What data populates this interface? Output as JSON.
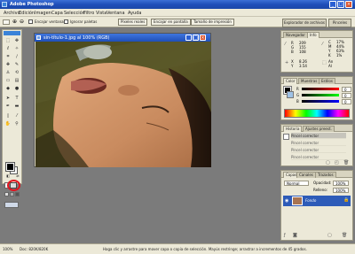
{
  "app": {
    "title": "Adobe Photoshop"
  },
  "window_controls": {
    "minimize": "_",
    "maximize": "□",
    "close": "×"
  },
  "menu": [
    "Archivo",
    "Edición",
    "Imagen",
    "Capa",
    "Selección",
    "Filtro",
    "Vista",
    "Ventana",
    "Ayuda"
  ],
  "options_bar": {
    "resize_windows_label": "Encajar ventanas",
    "ignore_palettes_label": "Ignorar paletas",
    "actual_pixels": "Píxeles reales",
    "fit_on_screen": "Encajar en pantalla",
    "print_size": "Tamaño de impresión",
    "file_browser": "Explorador de archivos",
    "brushes": "Pinceles"
  },
  "document": {
    "title": "sin-título-1.jpg al 100% (RGB)",
    "window_controls": {
      "minimize": "_",
      "maximize": "□",
      "close": "×"
    }
  },
  "navigator": {
    "tabs": [
      "Navegador",
      "Info"
    ],
    "readouts": [
      {
        "label": "R",
        "value": "209"
      },
      {
        "label": "G",
        "value": "155"
      },
      {
        "label": "B",
        "value": "108"
      },
      {
        "label": "C",
        "value": "17%"
      },
      {
        "label": "M",
        "value": "44%"
      },
      {
        "label": "Y",
        "value": "63%"
      },
      {
        "label": "K",
        "value": "1%"
      },
      {
        "label": "X",
        "value": "8.26"
      },
      {
        "label": "Y",
        "value": "3.54"
      },
      {
        "label": "An",
        "value": ""
      },
      {
        "label": "Al",
        "value": ""
      }
    ]
  },
  "color_panel": {
    "tabs": [
      "Color",
      "Muestras",
      "Estilos"
    ],
    "sliders": [
      {
        "label": "R",
        "value": "0",
        "color": "#e03030"
      },
      {
        "label": "G",
        "value": "0",
        "color": "#30b030"
      },
      {
        "label": "B",
        "value": "0",
        "color": "#3050e0"
      }
    ]
  },
  "history": {
    "tabs": [
      "Historia",
      "Ajustes preest."
    ],
    "items": [
      {
        "label": "Pincel corrector",
        "active": true
      },
      {
        "label": "Pincel corrector",
        "active": false
      },
      {
        "label": "Pincel corrector",
        "active": false
      },
      {
        "label": "Pincel corrector",
        "active": false
      }
    ]
  },
  "layers": {
    "tabs": [
      "Capas",
      "Canales",
      "Trazados"
    ],
    "blend_mode": "Normal",
    "opacity_label": "Opacidad:",
    "opacity": "100%",
    "fill_label": "Relleno:",
    "fill": "100%",
    "layer_name": "Fondo"
  },
  "statusbar": {
    "zoom": "100%",
    "doc_size": "Doc: 820K/820K",
    "hint": "Haga clic y arrastre para mover capa o copia de selección. Mayús restringe; arrastrar a incrementos de 45 grados."
  },
  "colors": {
    "title_blue": "#1f4fb9",
    "chrome": "#ece9d8",
    "workspace": "#7b7b7b",
    "highlight_red": "#e0141e"
  }
}
